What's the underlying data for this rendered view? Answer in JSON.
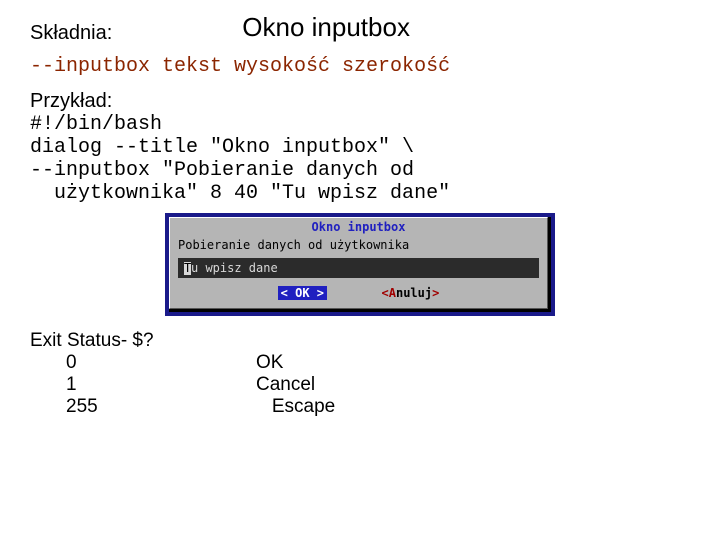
{
  "heading": "Okno inputbox",
  "labels": {
    "skladnia": "Składnia:",
    "przyklad": "Przykład:",
    "exit_status": "Exit Status- $?"
  },
  "syntax_line": "--inputbox tekst wysokość szerokość",
  "example_code": "#!/bin/bash\ndialog --title \"Okno inputbox\" \\\n--inputbox \"Pobieranie danych od\n  użytkownika\" 8 40 \"Tu wpisz dane\"",
  "dialog": {
    "title": "Okno inputbox",
    "prompt": "Pobieranie danych od użytkownika",
    "input_first_char": "T",
    "input_rest": "u wpisz dane",
    "ok_label": "<  OK  >",
    "cancel_open": "<",
    "cancel_hot": "A",
    "cancel_rest": "nuluj",
    "cancel_close": ">"
  },
  "exit": [
    {
      "code": "0",
      "meaning": "OK"
    },
    {
      "code": "1",
      "meaning": "Cancel"
    },
    {
      "code": "255",
      "meaning": "   Escape"
    }
  ]
}
